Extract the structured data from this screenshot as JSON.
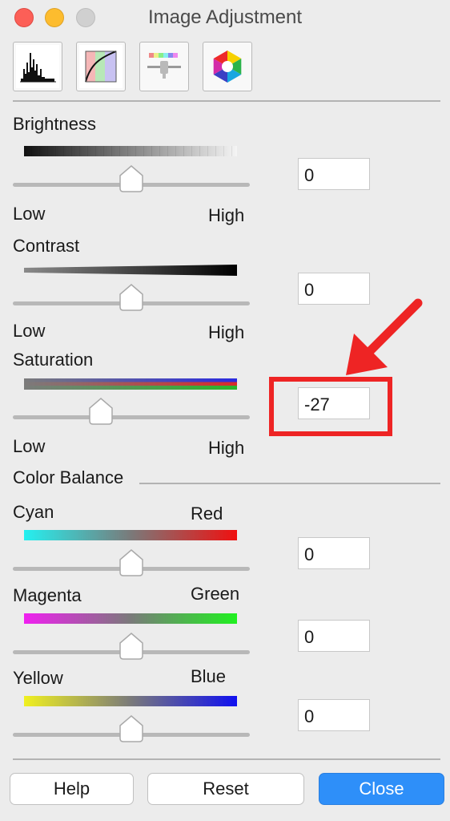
{
  "window": {
    "title": "Image Adjustment"
  },
  "toolbar": {
    "tools": [
      {
        "icon": "histogram-icon"
      },
      {
        "icon": "curves-icon"
      },
      {
        "icon": "levels-slider-icon"
      },
      {
        "icon": "color-wheel-icon"
      }
    ]
  },
  "brightness": {
    "label": "Brightness",
    "low": "Low",
    "high": "High",
    "value": "0",
    "slider_level": 0.5
  },
  "contrast": {
    "label": "Contrast",
    "low": "Low",
    "high": "High",
    "value": "0",
    "slider_level": 0.5
  },
  "saturation": {
    "label": "Saturation",
    "low": "Low",
    "high": "High",
    "value": "-27",
    "slider_level": 0.37
  },
  "color_balance": {
    "label": "Color Balance",
    "cyan_red": {
      "left": "Cyan",
      "right": "Red",
      "value": "0",
      "slider_level": 0.5
    },
    "magenta_green": {
      "left": "Magenta",
      "right": "Green",
      "value": "0",
      "slider_level": 0.5
    },
    "yellow_blue": {
      "left": "Yellow",
      "right": "Blue",
      "value": "0",
      "slider_level": 0.5
    }
  },
  "buttons": {
    "help": "Help",
    "reset": "Reset",
    "close": "Close"
  },
  "colors": {
    "accent": "#2e8ff9",
    "highlight": "#ee2424"
  }
}
